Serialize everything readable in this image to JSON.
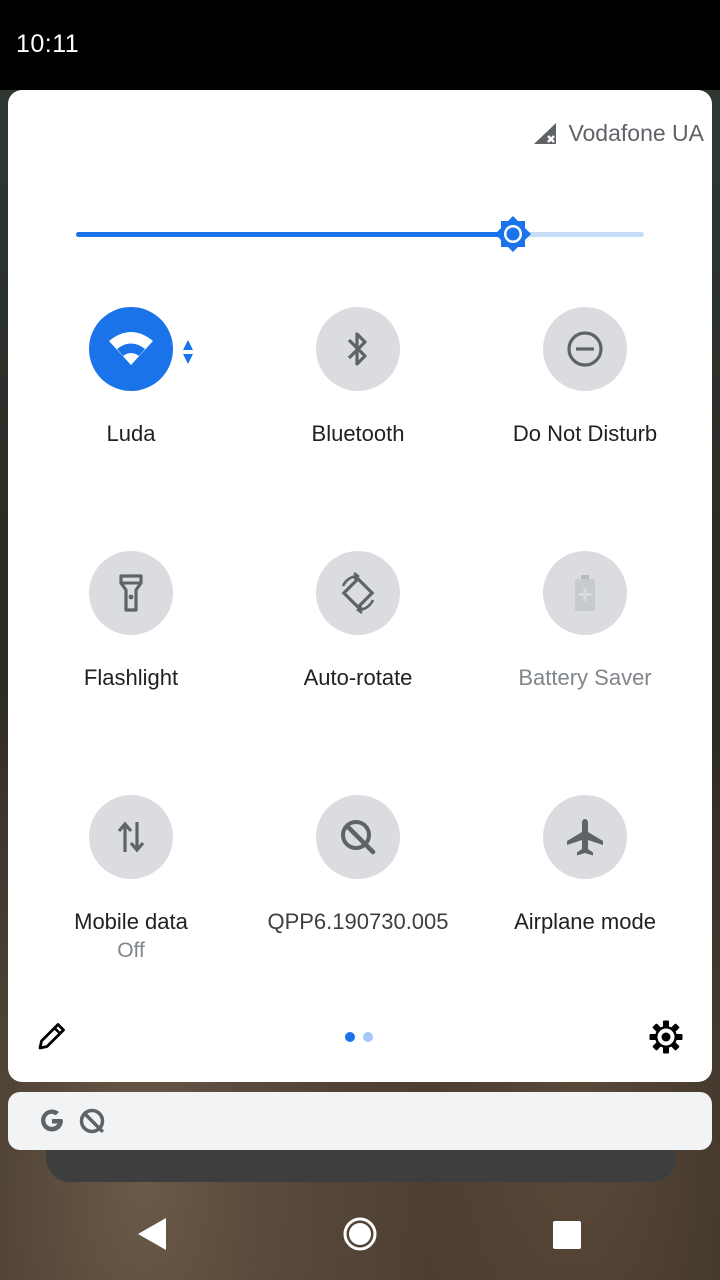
{
  "status_bar": {
    "time": "10:11"
  },
  "panel": {
    "carrier": "Vodafone UA",
    "brightness": 0.77,
    "tiles": [
      {
        "id": "wifi",
        "label": "Luda",
        "icon": "wifi-icon",
        "state": "on"
      },
      {
        "id": "bluetooth",
        "label": "Bluetooth",
        "icon": "bluetooth-icon",
        "state": "off"
      },
      {
        "id": "dnd",
        "label": "Do Not Disturb",
        "icon": "do-not-disturb-icon",
        "state": "off"
      },
      {
        "id": "flashlight",
        "label": "Flashlight",
        "icon": "flashlight-icon",
        "state": "off"
      },
      {
        "id": "autorotate",
        "label": "Auto-rotate",
        "icon": "auto-rotate-icon",
        "state": "off"
      },
      {
        "id": "battery",
        "label": "Battery Saver",
        "icon": "battery-saver-icon",
        "state": "unavailable"
      },
      {
        "id": "mobiledata",
        "label": "Mobile data",
        "sublabel": "Off",
        "icon": "mobile-data-icon",
        "state": "off"
      },
      {
        "id": "build",
        "label": "QPP6.190730.005",
        "icon": "android-q-icon",
        "state": "off"
      },
      {
        "id": "airplane",
        "label": "Airplane mode",
        "icon": "airplane-icon",
        "state": "off"
      }
    ],
    "page_indicator": {
      "pages": 2,
      "current": 1
    },
    "colors": {
      "accent": "#1a73e8",
      "tile_off": "#dadce0",
      "icon": "#5f6368"
    }
  },
  "search_bar": {
    "icons": [
      "google-icon",
      "android-q-icon"
    ]
  },
  "nav_bar": {
    "buttons": [
      "back-icon",
      "home-icon",
      "recents-icon"
    ]
  }
}
